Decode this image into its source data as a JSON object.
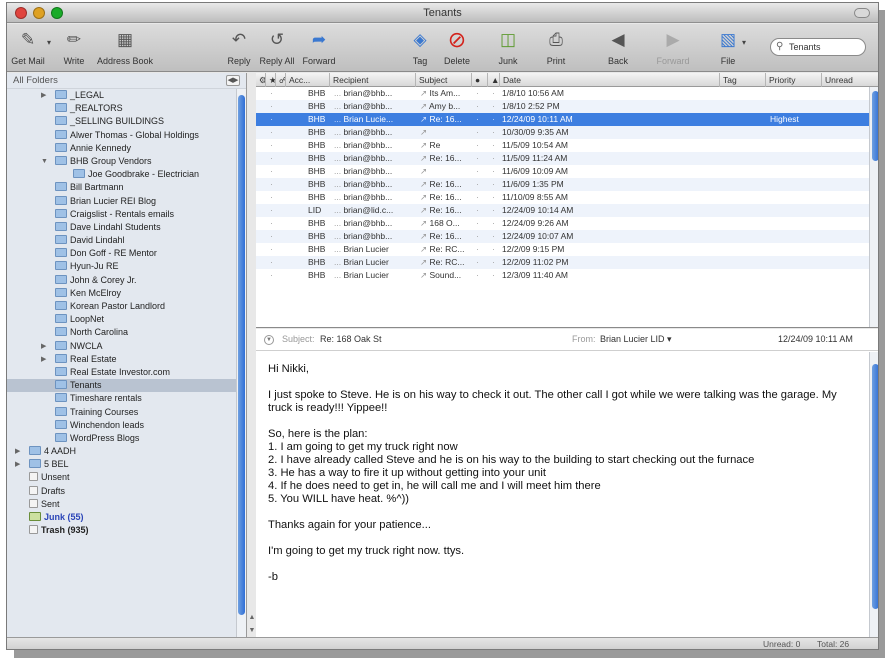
{
  "window": {
    "title": "Tenants"
  },
  "toolbar": {
    "get_mail": "Get Mail",
    "write": "Write",
    "address_book": "Address Book",
    "reply": "Reply",
    "reply_all": "Reply All",
    "forward": "Forward",
    "tag": "Tag",
    "delete": "Delete",
    "junk": "Junk",
    "print": "Print",
    "back": "Back",
    "forward_nav": "Forward",
    "file": "File",
    "search_value": "Tenants"
  },
  "sidebar": {
    "header": "All Folders",
    "folders": [
      {
        "name": "_LEGAL",
        "level": 1,
        "expander": "closed"
      },
      {
        "name": "_REALTORS",
        "level": 1
      },
      {
        "name": "_SELLING BUILDINGS",
        "level": 1
      },
      {
        "name": "Alwer Thomas - Global Holdings",
        "level": 1
      },
      {
        "name": "Annie Kennedy",
        "level": 1
      },
      {
        "name": "BHB Group Vendors",
        "level": 1,
        "expander": "open"
      },
      {
        "name": "Joe Goodbrake - Electrician",
        "level": 2
      },
      {
        "name": "Bill Bartmann",
        "level": 1
      },
      {
        "name": "Brian Lucier REI Blog",
        "level": 1
      },
      {
        "name": "Craigslist - Rentals emails",
        "level": 1
      },
      {
        "name": "Dave Lindahl Students",
        "level": 1
      },
      {
        "name": "David Lindahl",
        "level": 1
      },
      {
        "name": "Don Goff - RE Mentor",
        "level": 1
      },
      {
        "name": "Hyun-Ju RE",
        "level": 1
      },
      {
        "name": "John & Corey Jr.",
        "level": 1
      },
      {
        "name": "Ken McElroy",
        "level": 1
      },
      {
        "name": "Korean Pastor Landlord",
        "level": 1
      },
      {
        "name": "LoopNet",
        "level": 1
      },
      {
        "name": "North Carolina",
        "level": 1
      },
      {
        "name": "NWCLA",
        "level": 1,
        "expander": "closed"
      },
      {
        "name": "Real Estate",
        "level": 1,
        "expander": "closed"
      },
      {
        "name": "Real Estate Investor.com",
        "level": 1
      },
      {
        "name": "Tenants",
        "level": 1,
        "selected": true
      },
      {
        "name": "Timeshare rentals",
        "level": 1
      },
      {
        "name": "Training Courses",
        "level": 1
      },
      {
        "name": "Winchendon leads",
        "level": 1
      },
      {
        "name": "WordPress Blogs",
        "level": 1
      },
      {
        "name": "4 AADH",
        "level": 0,
        "expander": "closed"
      },
      {
        "name": "5 BEL",
        "level": 0,
        "expander": "closed"
      },
      {
        "name": "Unsent",
        "level": 0,
        "icon": "doc"
      },
      {
        "name": "Drafts",
        "level": 0,
        "icon": "doc"
      },
      {
        "name": "Sent",
        "level": 0,
        "icon": "doc"
      },
      {
        "name": "Junk (55)",
        "level": 0,
        "icon": "junk",
        "style": "blue"
      },
      {
        "name": "Trash (935)",
        "level": 0,
        "icon": "doc",
        "style": "bold"
      }
    ]
  },
  "message_list": {
    "columns": [
      "Acc...",
      "Recipient",
      "Subject",
      "Date",
      "Tag",
      "Priority",
      "Unread"
    ],
    "rows": [
      {
        "account": "BHB",
        "recipient": "brian@bhb...",
        "subject": "Its Am...",
        "date": "1/8/10 10:56 AM",
        "priority": ""
      },
      {
        "account": "BHB",
        "recipient": "brian@bhb...",
        "subject": "Amy b...",
        "date": "1/8/10 2:52 PM",
        "priority": ""
      },
      {
        "account": "BHB",
        "recipient": "Brian Lucie...",
        "subject": "Re: 16...",
        "date": "12/24/09 10:11 AM",
        "priority": "Highest",
        "selected": true
      },
      {
        "account": "BHB",
        "recipient": "brian@bhb...",
        "subject": "",
        "date": "10/30/09 9:35 AM",
        "priority": ""
      },
      {
        "account": "BHB",
        "recipient": "brian@bhb...",
        "subject": "Re",
        "date": "11/5/09 10:54 AM",
        "priority": ""
      },
      {
        "account": "BHB",
        "recipient": "brian@bhb...",
        "subject": "Re: 16...",
        "date": "11/5/09 11:24 AM",
        "priority": ""
      },
      {
        "account": "BHB",
        "recipient": "brian@bhb...",
        "subject": "",
        "date": "11/6/09 10:09 AM",
        "priority": ""
      },
      {
        "account": "BHB",
        "recipient": "brian@bhb...",
        "subject": "Re: 16...",
        "date": "11/6/09 1:35 PM",
        "priority": ""
      },
      {
        "account": "BHB",
        "recipient": "brian@bhb...",
        "subject": "Re: 16...",
        "date": "11/10/09 8:55 AM",
        "priority": ""
      },
      {
        "account": "LID",
        "recipient": "brian@lid.c...",
        "subject": "Re: 16...",
        "date": "12/24/09 10:14 AM",
        "priority": ""
      },
      {
        "account": "BHB",
        "recipient": "brian@bhb...",
        "subject": "168 O...",
        "date": "12/24/09 9:26 AM",
        "priority": ""
      },
      {
        "account": "BHB",
        "recipient": "brian@bhb...",
        "subject": "Re: 16...",
        "date": "12/24/09 10:07 AM",
        "priority": ""
      },
      {
        "account": "BHB",
        "recipient": "Brian Lucier",
        "subject": "Re: RC...",
        "date": "12/2/09 9:15 PM",
        "priority": ""
      },
      {
        "account": "BHB",
        "recipient": "Brian Lucier",
        "subject": "Re: RC...",
        "date": "12/2/09 11:02 PM",
        "priority": ""
      },
      {
        "account": "BHB",
        "recipient": "Brian Lucier",
        "subject": "Sound...",
        "date": "12/3/09 11:40 AM",
        "priority": ""
      }
    ]
  },
  "preview": {
    "subject_label": "Subject:",
    "subject": "Re: 168 Oak St",
    "from_label": "From:",
    "from": "Brian Lucier LID",
    "date": "12/24/09 10:11 AM",
    "greeting": "Hi Nikki,",
    "para1": "I just spoke to Steve. He is on his way to check it out. The other call I got while we were talking was the garage. My truck is ready!!! Yippee!!",
    "plan_intro": "So, here is the plan:",
    "plan": [
      "1. I am going to get my truck right now",
      "2. I have already called Steve and he is on his way to the building to start checking out the furnace",
      "3. He has a way to fire it up without getting into your unit",
      "4. If he does need to get in, he will call me and I will meet him there",
      "5. You WILL have heat.  %^))"
    ],
    "thanks": "Thanks again for your patience...",
    "closing": "I'm going to get my truck right now. ttys.",
    "signature": "-b"
  },
  "status": {
    "unread": "Unread: 0",
    "total": "Total: 26"
  }
}
